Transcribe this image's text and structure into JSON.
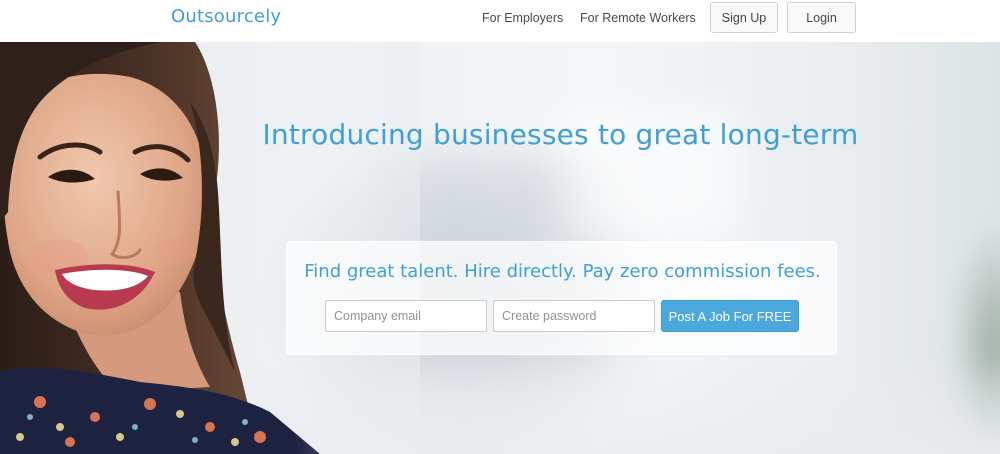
{
  "brand": {
    "logo_text": "Outsourcely",
    "accent_color": "#3fa0d6"
  },
  "nav": {
    "links": [
      "For Employers",
      "For Remote Workers"
    ],
    "signup_label": "Sign Up",
    "login_label": "Login"
  },
  "hero": {
    "headline": "Introducing businesses to great long-term",
    "image": "smiling-woman-photo"
  },
  "signup_card": {
    "title": "Find great talent. Hire directly. Pay zero commission fees.",
    "email_placeholder": "Company email",
    "password_placeholder": "Create password",
    "cta_label": "Post A Job For FREE",
    "cta_color": "#4aa8dc"
  }
}
